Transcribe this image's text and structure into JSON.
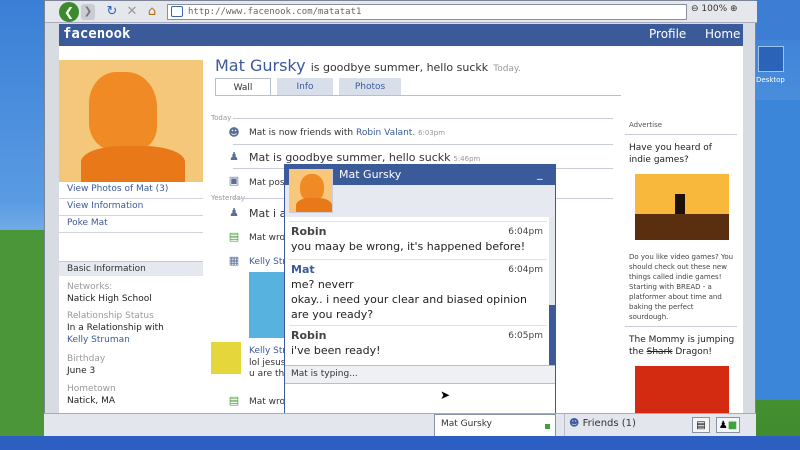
{
  "desktop": {
    "icon_label": "Desktop"
  },
  "browser": {
    "url": "http://www.facenook.com/matatat1",
    "zoom": "100%"
  },
  "header": {
    "logo": "facenook",
    "nav": [
      "Profile",
      "Home"
    ]
  },
  "profile": {
    "name": "Mat Gursky",
    "status": "is goodbye summer, hello suckk",
    "status_time": "Today.",
    "links": [
      "View Photos of Mat (3)",
      "View Information",
      "Poke Mat"
    ],
    "tabs": [
      "Wall",
      "Info",
      "Photos"
    ],
    "active_tab": "Wall"
  },
  "basic_info": {
    "title": "Basic Information",
    "networks_label": "Networks:",
    "networks": "Natick High School",
    "relationship_label": "Relationship Status",
    "relationship": "In a Relationship with",
    "relationship_with": "Kelly Struman",
    "birthday_label": "Birthday",
    "birthday": "June 3",
    "hometown_label": "Hometown",
    "hometown": "Natick, MA"
  },
  "feed": {
    "today_label": "Today",
    "yesterday_label": "Yesterday",
    "items": [
      {
        "text": "Mat is now friends with ",
        "link": "Robin Valant.",
        "time": "6:03pm"
      },
      {
        "text": "Mat is goodbye summer, hello suckk",
        "time": "5:46pm"
      },
      {
        "text": "Mat post"
      },
      {
        "text": "Mat i ar"
      },
      {
        "text": "Mat wro"
      },
      {
        "text": "Kelly Strun"
      },
      {
        "text": "Kelly Str"
      },
      {
        "text": "lol jesus"
      },
      {
        "text": "u are the"
      },
      {
        "text": "Mat wro"
      }
    ]
  },
  "ads": {
    "title": "Advertise",
    "ad1_head": "Have you heard of indie games?",
    "ad1_body": "Do you like video games? You should check out these new things called indie games! Starting with BREAD - a platformer about time and baking the perfect sourdough.",
    "ad2_head_pre": "The Mommy is jumping the ",
    "ad2_head_strike": "Shark",
    "ad2_head_post": " Dragon!"
  },
  "chat": {
    "title": "Mat Gursky",
    "minimize": "_",
    "messages": [
      {
        "from": "Robin",
        "time": "6:04pm",
        "lines": [
          "you maay be wrong, it's happened before!"
        ]
      },
      {
        "from": "Mat",
        "time": "6:04pm",
        "lines": [
          "me? neverr",
          "okay.. i need your clear and biased opinion",
          "are you ready?"
        ]
      },
      {
        "from": "Robin",
        "time": "6:05pm",
        "lines": [
          "i've been ready!"
        ]
      }
    ],
    "typing": "Mat is typing..."
  },
  "chatbar": {
    "open_chat": "Mat Gursky",
    "friends": "Friends (1)"
  },
  "colors": {
    "brand": "#3b5a9a",
    "robin": "#444444",
    "mat": "#3b5a9a",
    "online": "#3ba53b"
  }
}
